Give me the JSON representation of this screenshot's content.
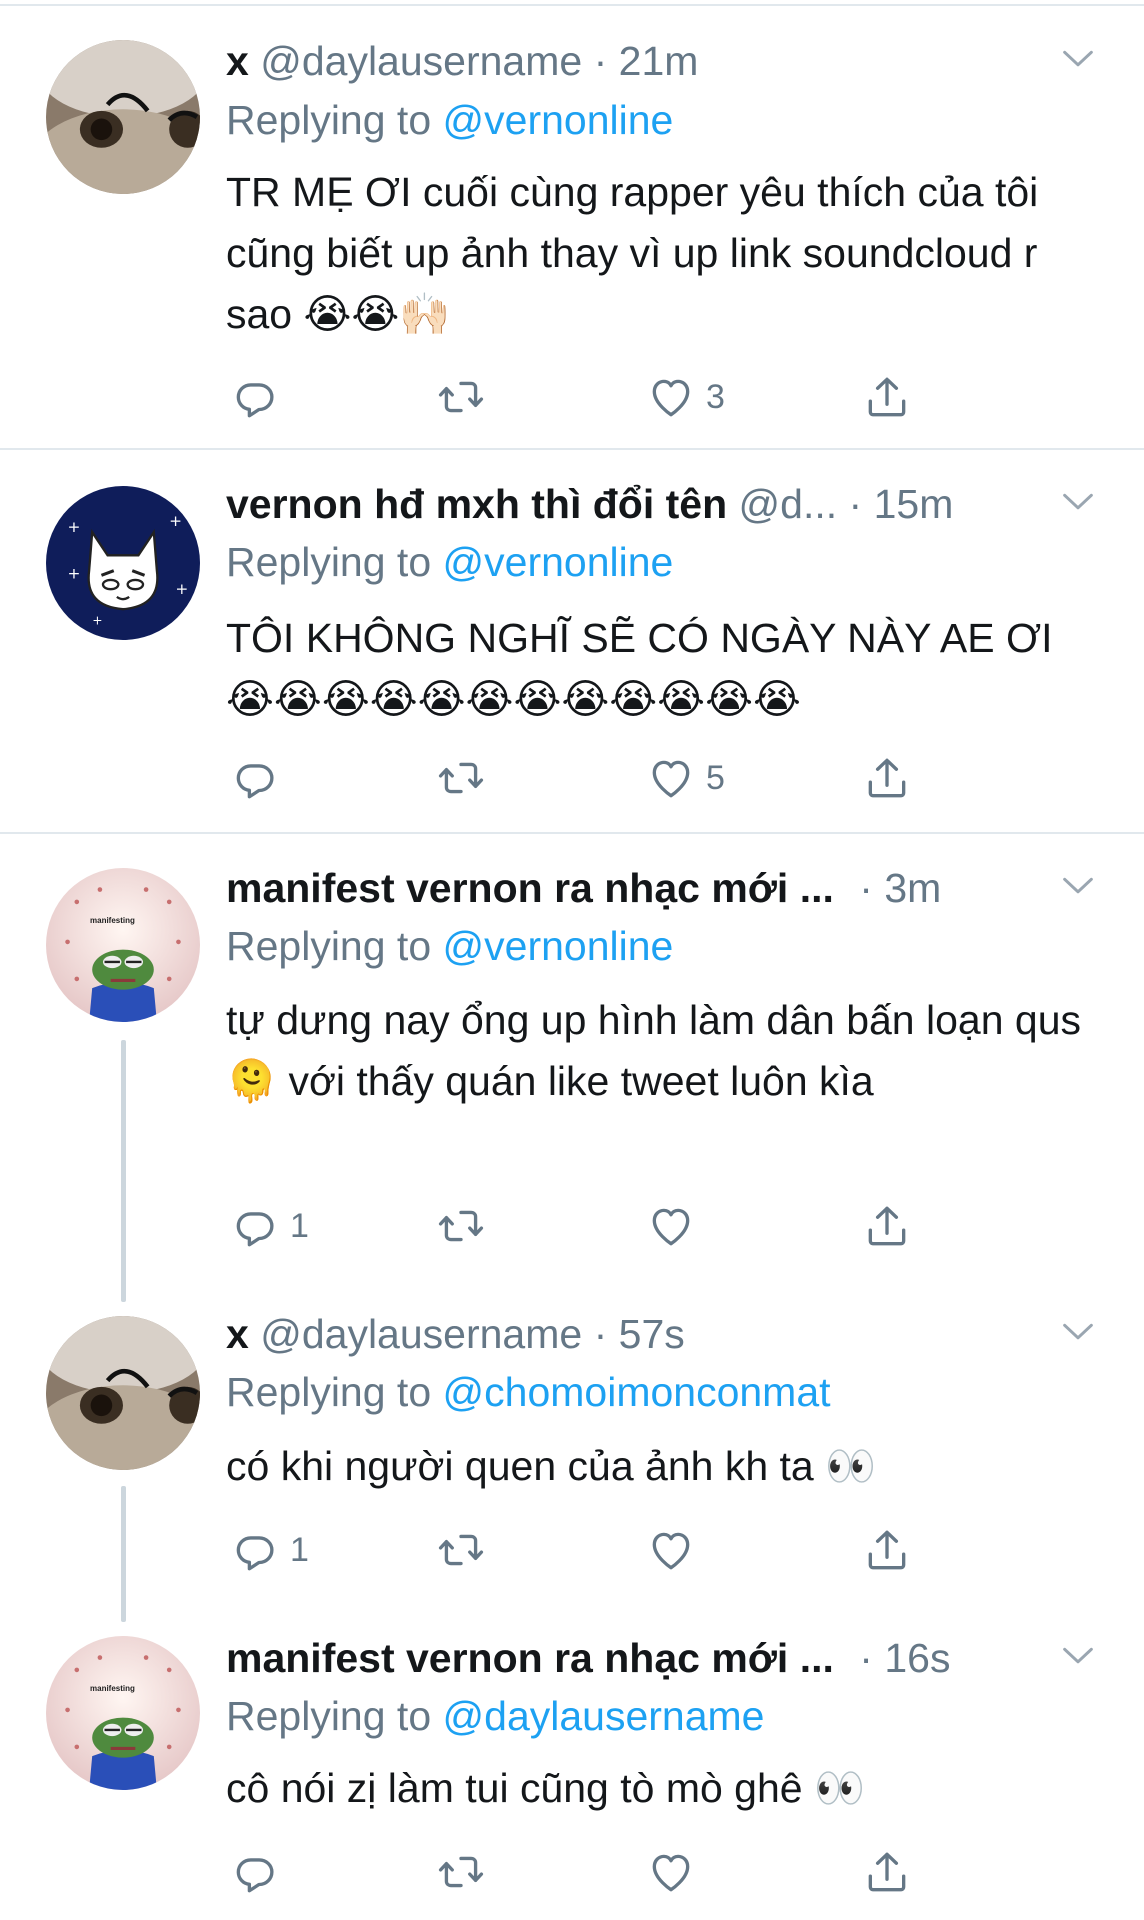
{
  "tweets": [
    {
      "name": "x",
      "handle": "@daylausername",
      "separator": "·",
      "time": "21m",
      "replying_label": "Replying to",
      "replying_user": "@vernonline",
      "text": "TR MẸ ƠI cuối cùng rapper yêu thích của tôi cũng biết up ảnh thay vì up link soundcloud r sao 😭😭🙌🏻",
      "reply_count": "",
      "retweet_count": "",
      "like_count": "3",
      "avatar": "cat-avatar"
    },
    {
      "name": "vernon hđ mxh thì đổi tên",
      "handle": "@d...",
      "separator": "·",
      "time": "15m",
      "replying_label": "Replying to",
      "replying_user": "@vernonline",
      "text": "TÔI KHÔNG NGHĨ SẼ CÓ NGÀY NÀY AE ƠI 😭😭😭😭😭😭😭😭😭😭😭😭",
      "reply_count": "",
      "retweet_count": "",
      "like_count": "5",
      "avatar": "cartoon-cat-avatar"
    },
    {
      "name": "manifest vernon ra nhạc mới ...",
      "handle": "",
      "separator": "·",
      "time": "3m",
      "replying_label": "Replying to",
      "replying_user": "@vernonline",
      "text": "tự dưng nay ổng up hình làm dân bấn loạn qus 🫠 với thấy quán like tweet luôn kìa",
      "reply_count": "1",
      "retweet_count": "",
      "like_count": "",
      "avatar": "pepe-avatar"
    },
    {
      "name": "x",
      "handle": "@daylausername",
      "separator": "·",
      "time": "57s",
      "replying_label": "Replying to",
      "replying_user": "@chomoimonconmat",
      "text": "có khi người quen của ảnh kh ta 👀",
      "reply_count": "1",
      "retweet_count": "",
      "like_count": "",
      "avatar": "cat-avatar"
    },
    {
      "name": "manifest vernon ra nhạc mới ...",
      "handle": "",
      "separator": "·",
      "time": "16s",
      "replying_label": "Replying to",
      "replying_user": "@daylausername",
      "text": "cô nói zị làm tui cũng tò mò ghê 👀",
      "reply_count": "",
      "retweet_count": "",
      "like_count": "",
      "avatar": "pepe-avatar"
    }
  ],
  "avatar_texts": {
    "manifesting": "manifesting"
  },
  "colors": {
    "link": "#1da1f2",
    "secondary": "#657786",
    "divider": "#e1e8ed"
  }
}
